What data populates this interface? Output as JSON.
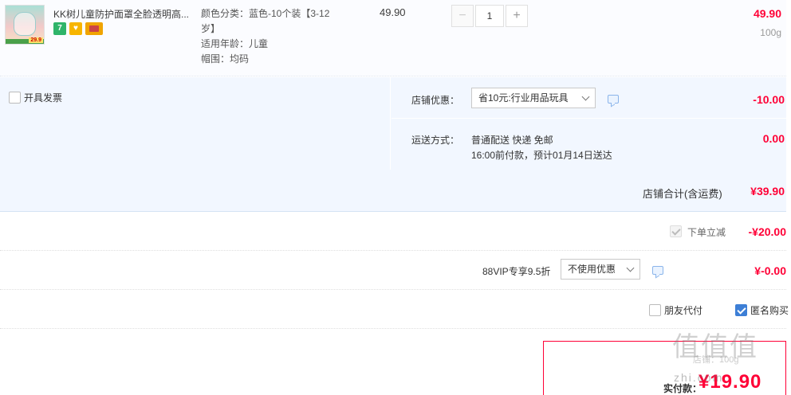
{
  "product": {
    "title": "KK树儿童防护面罩全脸透明高...",
    "thumb_price_tag": "29.9",
    "badges": [
      "7",
      "♥"
    ],
    "sku_lines": [
      "颜色分类：蓝色-10个装【3-12",
      "岁】",
      "适用年龄：儿童",
      "帽围：均码"
    ],
    "unit_price": "49.90",
    "qty_minus": "−",
    "qty_value": "1",
    "qty_plus": "+",
    "line_total": "49.90",
    "weight": "100g"
  },
  "invoice": {
    "label": "开具发票"
  },
  "shop_discount": {
    "label": "店铺优惠：",
    "selected": "省10元:行业用品玩具",
    "amount": "-10.00"
  },
  "shipping": {
    "label": "运送方式：",
    "line1": "普通配送 快递 免邮",
    "line2": "16:00前付款，预计01月14日送达",
    "fee": "0.00"
  },
  "shop_total": {
    "label": "店铺合计(含运费)",
    "amount": "¥39.90"
  },
  "instant_discount": {
    "label": "下单立减",
    "amount": "-¥20.00"
  },
  "vip": {
    "label": "88VIP专享9.5折",
    "selected": "不使用优惠",
    "amount": "¥-0.00"
  },
  "options": {
    "friend_pay": "朋友代付",
    "anonymous": "匿名购买"
  },
  "pay": {
    "label": "实付款：",
    "amount": "¥19.90",
    "ghost_text": "店铺：100g"
  },
  "watermark": {
    "chars": "值值值",
    "url": "zhi.com"
  }
}
